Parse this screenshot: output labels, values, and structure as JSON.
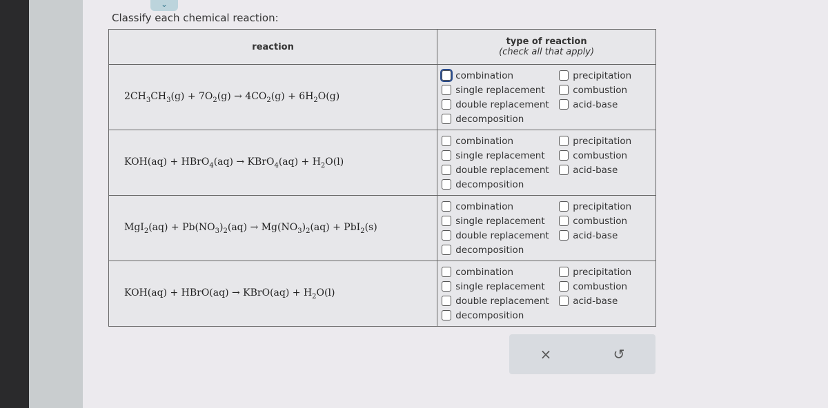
{
  "prompt": "Classify each chemical reaction:",
  "table": {
    "header_reaction": "reaction",
    "header_type": "type of reaction",
    "header_type_note": "(check all that apply)",
    "options_left": [
      "combination",
      "single replacement",
      "double replacement",
      "decomposition"
    ],
    "options_right": [
      "precipitation",
      "combustion",
      "acid-base"
    ],
    "rows": [
      {
        "reaction": [
          {
            "t": "2CH",
            "s": "3"
          },
          {
            "t": "CH",
            "s": "3"
          },
          {
            "t": "(g) + 7O",
            "s": "2"
          },
          {
            "t": "(g) → 4CO",
            "s": "2"
          },
          {
            "t": "(g) + 6H",
            "s": "2"
          },
          {
            "t": "O(g)",
            "s": ""
          }
        ]
      },
      {
        "reaction": [
          {
            "t": "KOH(aq) + HBrO",
            "s": "4"
          },
          {
            "t": "(aq) → KBrO",
            "s": "4"
          },
          {
            "t": "(aq) + H",
            "s": "2"
          },
          {
            "t": "O(l)",
            "s": ""
          }
        ]
      },
      {
        "reaction": [
          {
            "t": "MgI",
            "s": "2"
          },
          {
            "t": "(aq) + Pb(NO",
            "s": "3"
          },
          {
            "t": ")",
            "s": "2"
          },
          {
            "t": "(aq) → Mg(NO",
            "s": "3"
          },
          {
            "t": ")",
            "s": "2"
          },
          {
            "t": "(aq) + PbI",
            "s": "2"
          },
          {
            "t": "(s)",
            "s": ""
          }
        ]
      },
      {
        "reaction": [
          {
            "t": "KOH(aq) + HBrO(aq) → KBrO(aq) + H",
            "s": "2"
          },
          {
            "t": "O(l)",
            "s": ""
          }
        ]
      }
    ]
  },
  "actions": {
    "clear_icon": "×",
    "undo_icon": "↺"
  }
}
